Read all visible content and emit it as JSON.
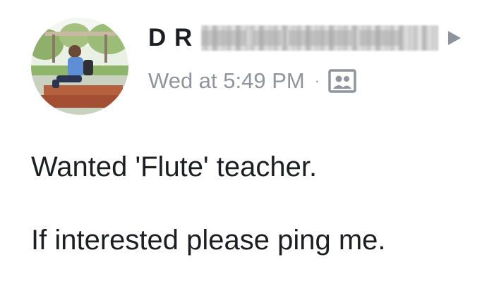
{
  "post": {
    "author": {
      "initials": "D R",
      "name_redacted": true
    },
    "meta": {
      "timestamp": "Wed at 5:49 PM",
      "separator": "·",
      "audience_icon": "friends-audience-icon"
    },
    "body": {
      "line1": "Wanted 'Flute' teacher.",
      "line2": "If interested please ping me."
    }
  },
  "colors": {
    "text": "#1c1e21",
    "meta": "#90949c",
    "arrow": "#8d949e",
    "background": "#ffffff"
  }
}
